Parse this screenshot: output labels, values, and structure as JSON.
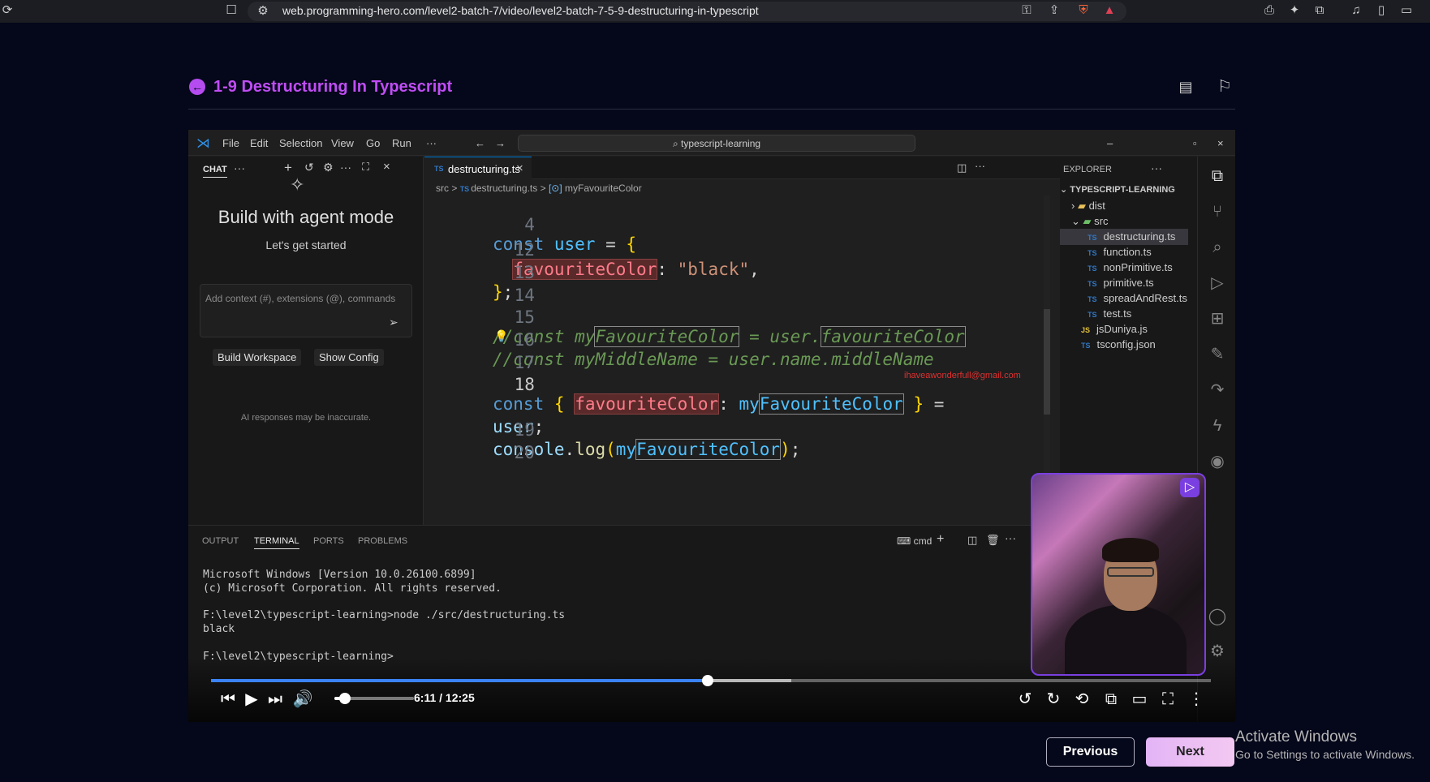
{
  "browser": {
    "url": "web.programming-hero.com/level2-batch-7/video/level2-batch-7-5-9-destructuring-in-typescript"
  },
  "page": {
    "title": "1-9 Destructuring In Typescript",
    "previous_label": "Previous",
    "next_label": "Next",
    "activate_title": "Activate Windows",
    "activate_sub": "Go to Settings to activate Windows."
  },
  "vscode": {
    "menu": [
      "File",
      "Edit",
      "Selection",
      "View",
      "Go",
      "Run",
      "···"
    ],
    "search_text": "typescript-learning",
    "chat": {
      "tab": "CHAT",
      "heading": "Build with agent mode",
      "sub": "Let's get started",
      "input_placeholder": "Add context (#), extensions (@), commands",
      "build_workspace": "Build Workspace",
      "show_config": "Show Config",
      "disclaimer": "AI responses may be inaccurate."
    },
    "editor": {
      "tab": "destructuring.ts",
      "breadcrumb": [
        "src",
        "destructuring.ts",
        "myFavouriteColor"
      ],
      "lines": [
        {
          "n": "4"
        },
        {
          "n": "12"
        },
        {
          "n": "13"
        },
        {
          "n": "14"
        },
        {
          "n": "15"
        },
        {
          "n": "16"
        },
        {
          "n": "17"
        },
        {
          "n": "18"
        },
        {
          "n": ""
        },
        {
          "n": "19"
        },
        {
          "n": "20"
        }
      ],
      "overlay_email": "ihaveawonderfull@gmail.com"
    },
    "explorer": {
      "title": "EXPLORER",
      "root": "TYPESCRIPT-LEARNING",
      "folders": [
        "dist",
        "src"
      ],
      "files": [
        "destructuring.ts",
        "function.ts",
        "nonPrimitive.ts",
        "primitive.ts",
        "spreadAndRest.ts",
        "test.ts"
      ],
      "root_files": [
        "jsDuniya.js",
        "tsconfig.json"
      ]
    },
    "terminal": {
      "tabs": [
        "OUTPUT",
        "TERMINAL",
        "PORTS",
        "PROBLEMS"
      ],
      "shell": "cmd",
      "lines": [
        "Microsoft Windows [Version 10.0.26100.6899]",
        "(c) Microsoft Corporation. All rights reserved.",
        "",
        "F:\\level2\\typescript-learning>node ./src/destructuring.ts",
        "black",
        "",
        "F:\\level2\\typescript-learning>"
      ]
    }
  },
  "player": {
    "current_time": "6:11",
    "duration": "12:25",
    "time_text": "6:11 / 12:25",
    "progress": 0.4966,
    "buffered": 0.58,
    "volume": 0.13
  }
}
